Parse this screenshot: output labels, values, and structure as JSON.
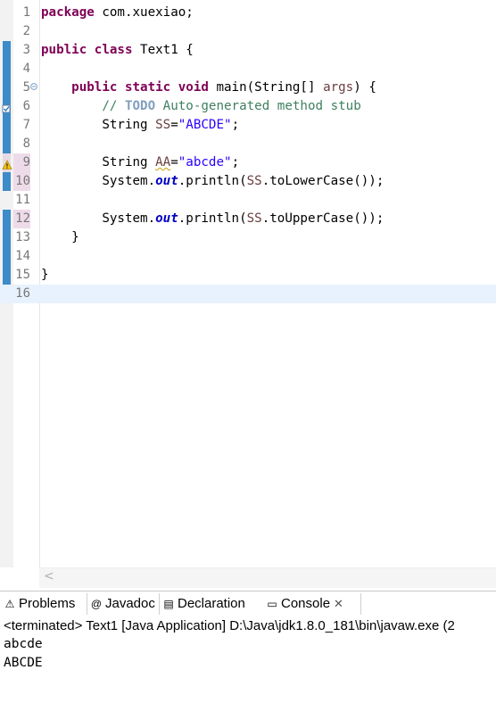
{
  "editor": {
    "lines": [
      {
        "num": "1",
        "tokens": [
          {
            "t": "package",
            "c": "kw"
          },
          {
            "t": " com.xuexiao;",
            "c": ""
          }
        ]
      },
      {
        "num": "2",
        "tokens": []
      },
      {
        "num": "3",
        "tokens": [
          {
            "t": "public",
            "c": "kw"
          },
          {
            "t": " ",
            "c": ""
          },
          {
            "t": "class",
            "c": "kw"
          },
          {
            "t": " Text1 {",
            "c": ""
          }
        ]
      },
      {
        "num": "4",
        "tokens": []
      },
      {
        "num": "5",
        "tokens": [
          {
            "t": "    ",
            "c": ""
          },
          {
            "t": "public",
            "c": "kw"
          },
          {
            "t": " ",
            "c": ""
          },
          {
            "t": "static",
            "c": "kw"
          },
          {
            "t": " ",
            "c": ""
          },
          {
            "t": "void",
            "c": "kw"
          },
          {
            "t": " main(String[] ",
            "c": ""
          },
          {
            "t": "args",
            "c": "var"
          },
          {
            "t": ") {",
            "c": ""
          }
        ]
      },
      {
        "num": "6",
        "tokens": [
          {
            "t": "        ",
            "c": ""
          },
          {
            "t": "// ",
            "c": "cm"
          },
          {
            "t": "TODO",
            "c": "todo"
          },
          {
            "t": " Auto-generated method stub",
            "c": "cm"
          }
        ]
      },
      {
        "num": "7",
        "tokens": [
          {
            "t": "        String ",
            "c": ""
          },
          {
            "t": "SS",
            "c": "var"
          },
          {
            "t": "=",
            "c": ""
          },
          {
            "t": "\"ABCDE\"",
            "c": "str"
          },
          {
            "t": ";",
            "c": ""
          }
        ]
      },
      {
        "num": "8",
        "tokens": []
      },
      {
        "num": "9",
        "tokens": [
          {
            "t": "        String ",
            "c": ""
          },
          {
            "t": "AA",
            "c": "warnvar"
          },
          {
            "t": "=",
            "c": ""
          },
          {
            "t": "\"abcde\"",
            "c": "str"
          },
          {
            "t": ";",
            "c": ""
          }
        ]
      },
      {
        "num": "10",
        "tokens": [
          {
            "t": "        System.",
            "c": ""
          },
          {
            "t": "out",
            "c": "fld"
          },
          {
            "t": ".println(",
            "c": ""
          },
          {
            "t": "SS",
            "c": "var"
          },
          {
            "t": ".toLowerCase());",
            "c": ""
          }
        ]
      },
      {
        "num": "11",
        "tokens": []
      },
      {
        "num": "12",
        "tokens": [
          {
            "t": "        System.",
            "c": ""
          },
          {
            "t": "out",
            "c": "fld"
          },
          {
            "t": ".println(",
            "c": ""
          },
          {
            "t": "SS",
            "c": "var"
          },
          {
            "t": ".toUpperCase());",
            "c": ""
          }
        ]
      },
      {
        "num": "13",
        "tokens": [
          {
            "t": "    }",
            "c": ""
          }
        ]
      },
      {
        "num": "14",
        "tokens": []
      },
      {
        "num": "15",
        "tokens": [
          {
            "t": "}",
            "c": ""
          }
        ]
      },
      {
        "num": "16",
        "tokens": []
      }
    ],
    "current_line": "16",
    "scroll_left_glyph": "<"
  },
  "views": {
    "tabs": [
      {
        "label": "Problems",
        "icon": "problems-icon",
        "glyph": "⚠",
        "name": "tab-problems"
      },
      {
        "label": "Javadoc",
        "icon": "javadoc-icon",
        "glyph": "@",
        "name": "tab-javadoc"
      },
      {
        "label": "Declaration",
        "icon": "declaration-icon",
        "glyph": "▤",
        "name": "tab-declaration"
      },
      {
        "label": "Console",
        "icon": "console-icon",
        "glyph": "▭",
        "name": "tab-console"
      }
    ],
    "active_tab": "Console",
    "close_glyph": "✕",
    "terminated_text": "<terminated> Text1 [Java Application] D:\\Java\\jdk1.8.0_181\\bin\\javaw.exe (2",
    "output": [
      "abcde",
      "ABCDE"
    ]
  }
}
